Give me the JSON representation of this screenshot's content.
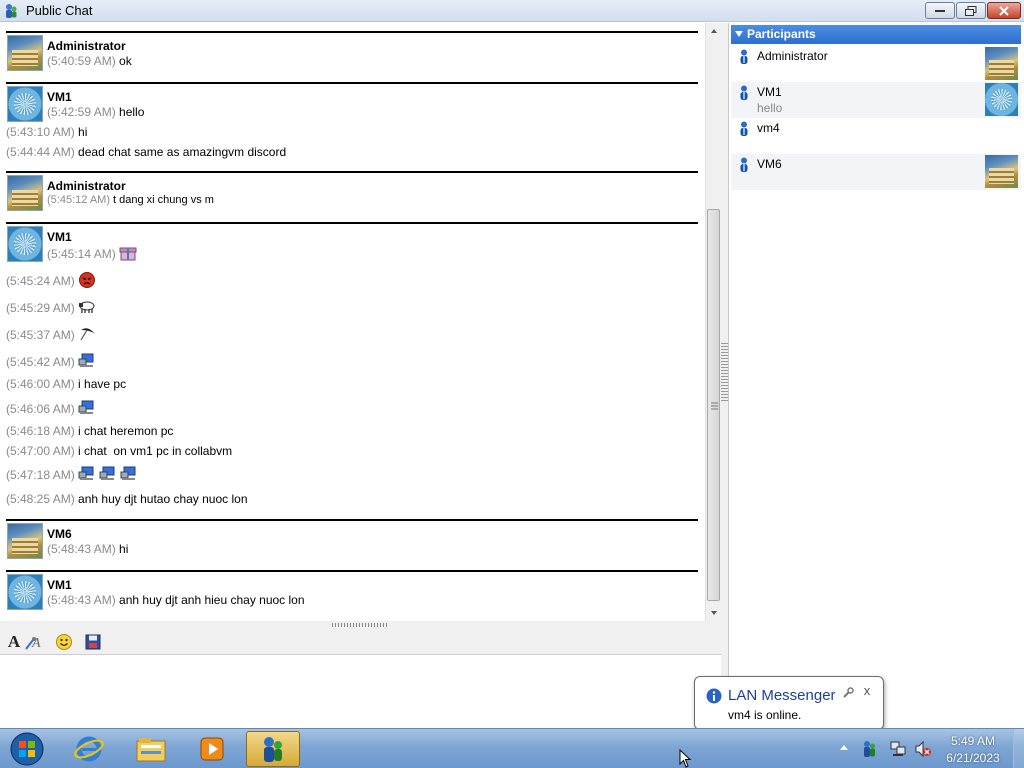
{
  "window": {
    "title": "Public Chat"
  },
  "chat": {
    "blocks": [
      {
        "sender": "Administrator",
        "avatar": "stairs-picture",
        "lines": [
          {
            "time": "(5:40:59 AM)",
            "text": "ok"
          }
        ]
      },
      {
        "sender": "VM1",
        "avatar": "flower-picture",
        "lines": [
          {
            "time": "(5:42:59 AM)",
            "text": "hello"
          },
          {
            "time": "(5:43:10 AM)",
            "text": "hi"
          },
          {
            "time": "(5:44:44 AM)",
            "text": "dead chat same as amazingvm discord"
          }
        ]
      },
      {
        "sender": "Administrator",
        "avatar": "stairs-picture",
        "lines": [
          {
            "time": "(5:45:12 AM)",
            "text": "t dang xi chung vs m"
          }
        ]
      },
      {
        "sender": "VM1",
        "avatar": "flower-picture",
        "lines": [
          {
            "time": "(5:45:14 AM)",
            "text": "",
            "emoticons": [
              "gift-icon"
            ]
          },
          {
            "time": "(5:45:24 AM)",
            "text": "",
            "emoticons": [
              "angry-face-icon"
            ]
          },
          {
            "time": "(5:45:29 AM)",
            "text": "",
            "emoticons": [
              "sheep-icon"
            ]
          },
          {
            "time": "(5:45:37 AM)",
            "text": "",
            "emoticons": [
              "umbrella-icon"
            ]
          },
          {
            "time": "(5:45:42 AM)",
            "text": "",
            "emoticons": [
              "computer-icon"
            ]
          },
          {
            "time": "(5:46:00 AM)",
            "text": "i have pc"
          },
          {
            "time": "(5:46:06 AM)",
            "text": "",
            "emoticons": [
              "computer-icon"
            ]
          },
          {
            "time": "(5:46:18 AM)",
            "text": "i chat heremon pc"
          },
          {
            "time": "(5:47:00 AM)",
            "text": "i chat  on vm1 pc in collabvm"
          },
          {
            "time": "(5:47:18 AM)",
            "text": "",
            "emoticons": [
              "computer-icon",
              "computer-icon",
              "computer-icon"
            ]
          },
          {
            "time": "(5:48:25 AM)",
            "text": "anh huy djt hutao chay nuoc lon"
          }
        ]
      },
      {
        "sender": "VM6",
        "avatar": "stairs-picture",
        "lines": [
          {
            "time": "(5:48:43 AM)",
            "text": "hi"
          }
        ]
      },
      {
        "sender": "VM1",
        "avatar": "flower-picture",
        "lines": [
          {
            "time": "(5:48:43 AM)",
            "text": "anh huy djt anh hieu chay nuoc lon"
          }
        ]
      }
    ]
  },
  "toolbar": {
    "font_label": "A",
    "icons": [
      "font-icon",
      "font-color-icon",
      "smiley-icon",
      "save-icon"
    ]
  },
  "input": {
    "value": ""
  },
  "participants": {
    "header": "Participants",
    "items": [
      {
        "name": "Administrator",
        "note": "",
        "avatar": "stairs-picture"
      },
      {
        "name": "VM1",
        "note": "hello",
        "avatar": "flower-picture"
      },
      {
        "name": "vm4",
        "note": "",
        "avatar": ""
      },
      {
        "name": "VM6",
        "note": "",
        "avatar": "stairs-picture"
      }
    ]
  },
  "notification": {
    "title": "LAN Messenger",
    "text": "vm4 is online.",
    "close_label": "x"
  },
  "taskbar": {
    "apps": [
      "internet-explorer-icon",
      "file-explorer-icon",
      "media-player-icon",
      "lan-messenger-icon"
    ],
    "clock": {
      "time": "5:49 AM",
      "date": "6/21/2023"
    }
  },
  "colors": {
    "timestamp": "#8a8a8a",
    "participants_header": "#2d6fcf",
    "notification_title": "#1a3f9e",
    "taskbar": "#7ea6d4"
  }
}
